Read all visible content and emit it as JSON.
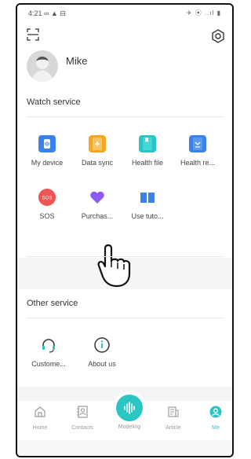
{
  "status_bar": {
    "time": "4:21 ∞ ▲ ⊟",
    "icons": "✈ ⦿ ..ıl ▮"
  },
  "profile": {
    "username": "Mike"
  },
  "watch_service": {
    "title": "Watch service",
    "items": [
      {
        "label": "My device",
        "icon": "watch-icon",
        "color": "#3b82e8"
      },
      {
        "label": "Data sync",
        "icon": "data-sync-icon",
        "color": "#f5a623"
      },
      {
        "label": "Health file",
        "icon": "health-file-icon",
        "color": "#2bc5c5"
      },
      {
        "label": "Health re...",
        "icon": "health-report-icon",
        "color": "#3b82e8"
      },
      {
        "label": "SOS",
        "icon": "sos-icon",
        "color": "#f05555"
      },
      {
        "label": "Purchas...",
        "icon": "purchase-icon",
        "color": "#8a5cf0"
      },
      {
        "label": "Use tuto...",
        "icon": "tutorial-icon",
        "color": "#3b82e8"
      }
    ]
  },
  "other_service": {
    "title": "Other service",
    "items": [
      {
        "label": "Custome...",
        "icon": "headset-icon"
      },
      {
        "label": "About us",
        "icon": "info-icon"
      }
    ]
  },
  "bottom_nav": {
    "items": [
      {
        "label": "Home",
        "icon": "home-icon"
      },
      {
        "label": "Contacts",
        "icon": "contacts-icon"
      },
      {
        "label": "Modeling",
        "icon": "waveform-icon"
      },
      {
        "label": "Article",
        "icon": "article-icon"
      },
      {
        "label": "Me",
        "icon": "profile-icon",
        "active": true
      }
    ]
  },
  "colors": {
    "accent": "#2bc5c5"
  }
}
